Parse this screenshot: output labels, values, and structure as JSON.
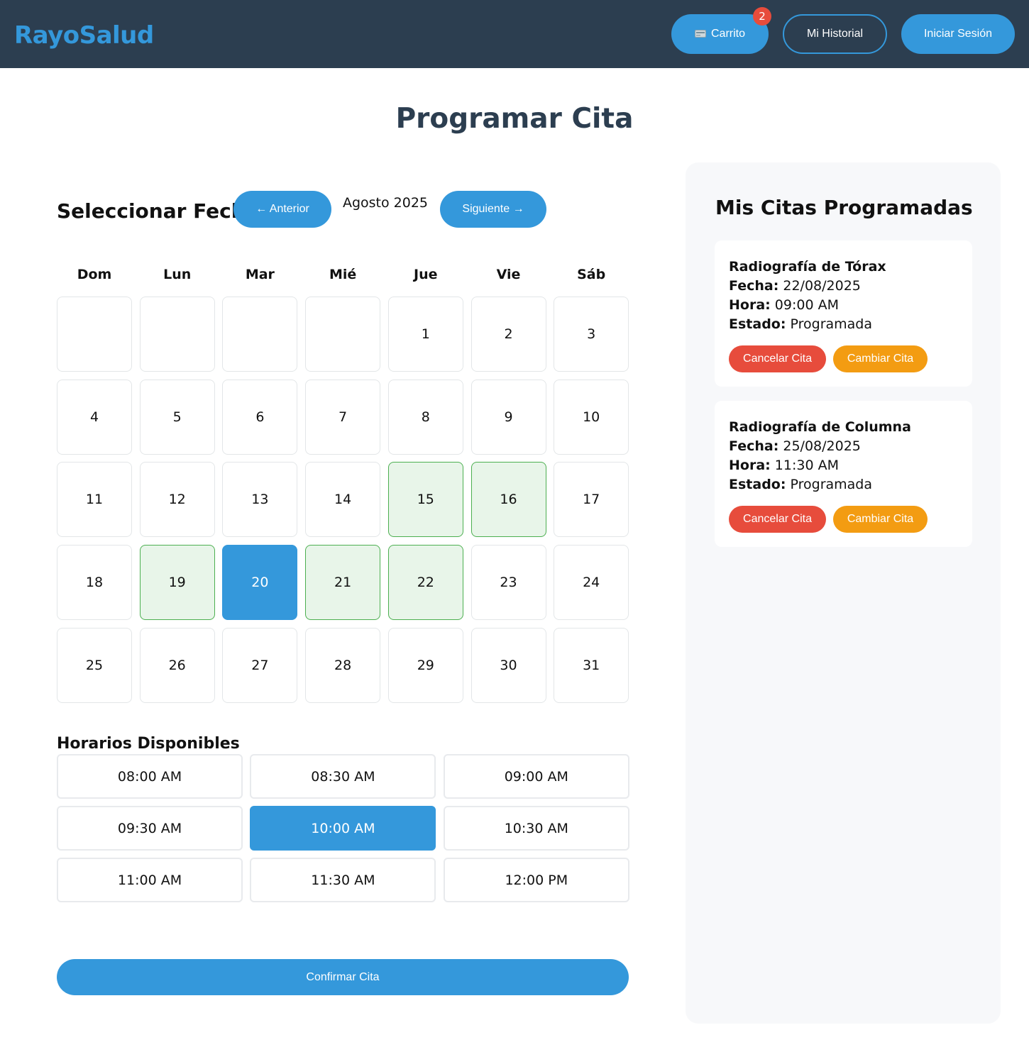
{
  "header": {
    "logo": "RayoSalud",
    "cart_label": "Carrito",
    "cart_count": "2",
    "history_label": "Mi Historial",
    "login_label": "Iniciar Sesión"
  },
  "page_title": "Programar Cita",
  "calendar": {
    "section_title": "Seleccionar Fecha",
    "prev_label": "← Anterior",
    "next_label": "Siguiente →",
    "month_label": "Agosto 2025",
    "weekdays": [
      "Dom",
      "Lun",
      "Mar",
      "Mié",
      "Jue",
      "Vie",
      "Sáb"
    ],
    "first_weekday_index": 4,
    "days_in_month": 31,
    "available_days": [
      15,
      16,
      19,
      21,
      22
    ],
    "selected_day": 20
  },
  "slots": {
    "title": "Horarios Disponibles",
    "items": [
      "08:00 AM",
      "08:30 AM",
      "09:00 AM",
      "09:30 AM",
      "10:00 AM",
      "10:30 AM",
      "11:00 AM",
      "11:30 AM",
      "12:00 PM"
    ],
    "selected": "10:00 AM"
  },
  "confirm_label": "Confirmar Cita",
  "appointments": {
    "title": "Mis Citas Programadas",
    "date_label": "Fecha:",
    "time_label": "Hora:",
    "status_label": "Estado:",
    "cancel_label": "Cancelar Cita",
    "change_label": "Cambiar Cita",
    "items": [
      {
        "name": "Radiografía de Tórax",
        "date": "22/08/2025",
        "time": "09:00 AM",
        "status": "Programada"
      },
      {
        "name": "Radiografía de Columna",
        "date": "25/08/2025",
        "time": "11:30 AM",
        "status": "Programada"
      }
    ]
  },
  "colors": {
    "header_bg": "#2c3e50",
    "accent": "#3498db",
    "available_bg": "#e8f5e9",
    "available_border": "#4caf50",
    "danger": "#e74c3c",
    "warning": "#f39c12"
  }
}
